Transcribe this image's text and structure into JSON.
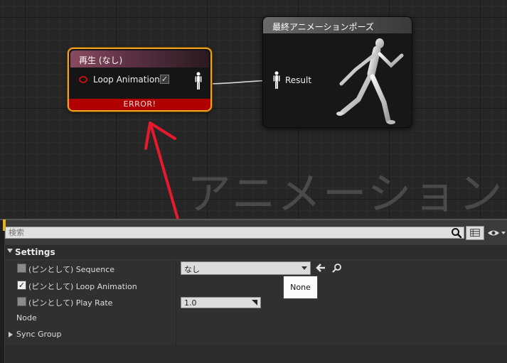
{
  "graph": {
    "watermark": "アニメーション",
    "play_node": {
      "title": "再生 (なし)",
      "loop_label": "Loop Animation",
      "error": "ERROR!"
    },
    "result_node": {
      "title": "最終アニメーションポーズ",
      "result_label": "Result"
    }
  },
  "details": {
    "search_placeholder": "検索",
    "section_title": "Settings",
    "rows": {
      "sequence_label": "(ピンとして) Sequence",
      "sequence_value": "なし",
      "loop_label": "(ピンとして) Loop Animation",
      "play_rate_label": "(ピンとして) Play Rate",
      "play_rate_value": "1.0",
      "node_label": "Node",
      "sync_group_label": "Sync Group"
    },
    "tooltip": "None"
  },
  "colors": {
    "play_node_border": "#f0a020",
    "error_bar": "#b00000",
    "annotation_arrow": "#e8192c",
    "settings_accent": "#e8b020"
  },
  "icons": [
    "exec-pin-icon",
    "checkbox-icon",
    "pose-pin-icon",
    "running-mannequin-icon",
    "search-icon",
    "grid-view-icon",
    "eye-icon",
    "back-arrow-icon",
    "browse-icon",
    "drag-handle-icon"
  ]
}
